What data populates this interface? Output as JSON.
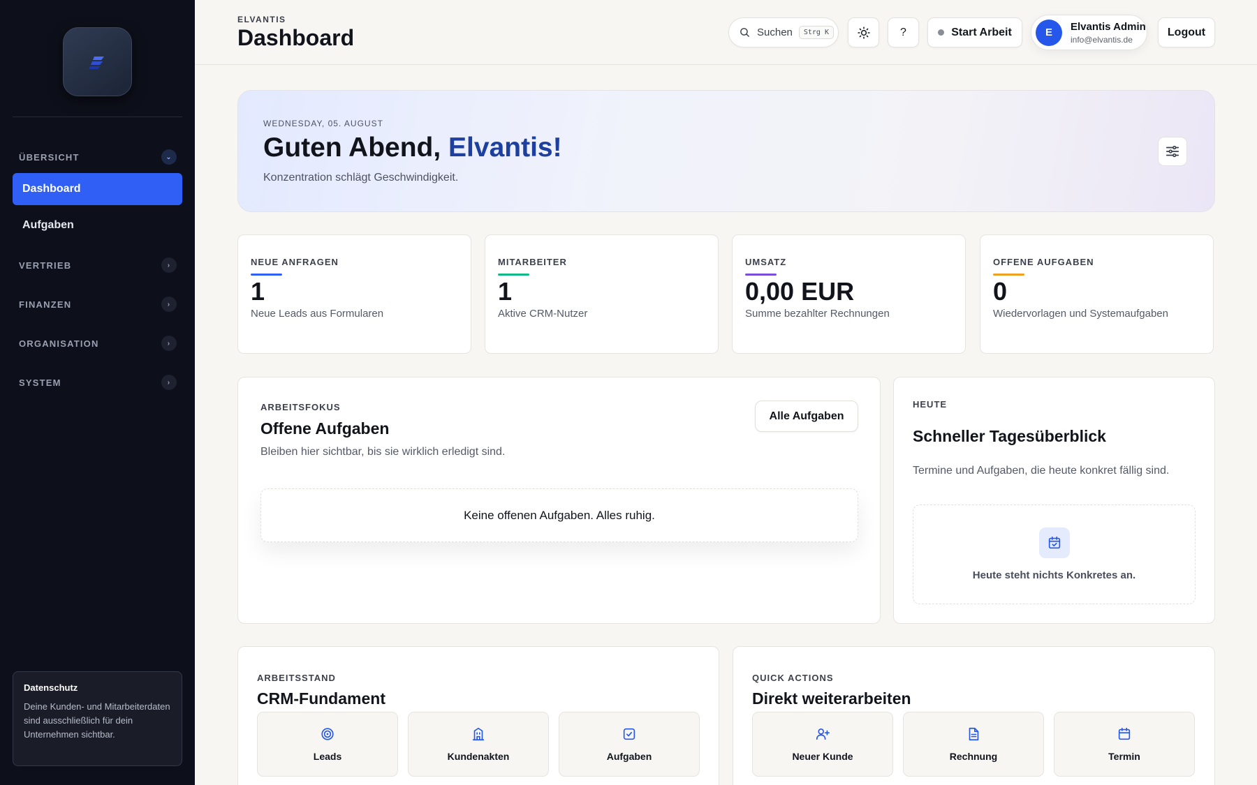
{
  "sidebar": {
    "sections": {
      "uebersicht": "ÜBERSICHT",
      "vertrieb": "VERTRIEB",
      "finanzen": "FINANZEN",
      "organisation": "ORGANISATION",
      "system": "SYSTEM"
    },
    "items": {
      "dashboard": "Dashboard",
      "aufgaben": "Aufgaben"
    },
    "privacy": {
      "title": "Datenschutz",
      "text": "Deine Kunden- und Mitarbeiterdaten sind ausschließlich für dein Unternehmen sichtbar."
    }
  },
  "header": {
    "brand": "ELVANTIS",
    "title": "Dashboard",
    "search_label": "Suchen",
    "search_shortcut": "Strg K",
    "help_label": "?",
    "start_work": "Start Arbeit",
    "user": {
      "initial": "E",
      "name": "Elvantis Admin",
      "email": "info@elvantis.de"
    },
    "logout": "Logout"
  },
  "hero": {
    "date": "WEDNESDAY, 05. AUGUST",
    "greeting_prefix": "Guten Abend, ",
    "greeting_name": "Elvantis!",
    "subtitle": "Konzentration schlägt Geschwindigkeit."
  },
  "stats": [
    {
      "label": "NEUE ANFRAGEN",
      "value": "1",
      "desc": "Neue Leads aus Formularen",
      "color": "#2f5ff5"
    },
    {
      "label": "MITARBEITER",
      "value": "1",
      "desc": "Aktive CRM-Nutzer",
      "color": "#12b886"
    },
    {
      "label": "UMSATZ",
      "value": "0,00 EUR",
      "desc": "Summe bezahlter Rechnungen",
      "color": "#7c4ddb"
    },
    {
      "label": "OFFENE AUFGABEN",
      "value": "0",
      "desc": "Wiedervorlagen und Systemaufgaben",
      "color": "#f0a020"
    }
  ],
  "tasks_panel": {
    "label": "ARBEITSFOKUS",
    "title": "Offene Aufgaben",
    "subtitle": "Bleiben hier sichtbar, bis sie wirklich erledigt sind.",
    "button": "Alle Aufgaben",
    "empty": "Keine offenen Aufgaben. Alles ruhig."
  },
  "today_panel": {
    "label": "HEUTE",
    "title": "Schneller Tagesüberblick",
    "subtitle": "Termine und Aufgaben, die heute konkret fällig sind.",
    "empty": "Heute steht nichts Konkretes an."
  },
  "crm_panel": {
    "label": "ARBEITSSTAND",
    "title": "CRM-Fundament",
    "tiles": [
      "Leads",
      "Kundenakten",
      "Aufgaben"
    ]
  },
  "quick_panel": {
    "label": "QUICK ACTIONS",
    "title": "Direkt weiterarbeiten",
    "tiles": [
      "Neuer Kunde",
      "Rechnung",
      "Termin"
    ]
  },
  "colors": {
    "accent": "#2f5ff5",
    "sidebar_bg": "#0d0f1a",
    "icon_blue": "#2558ea"
  }
}
